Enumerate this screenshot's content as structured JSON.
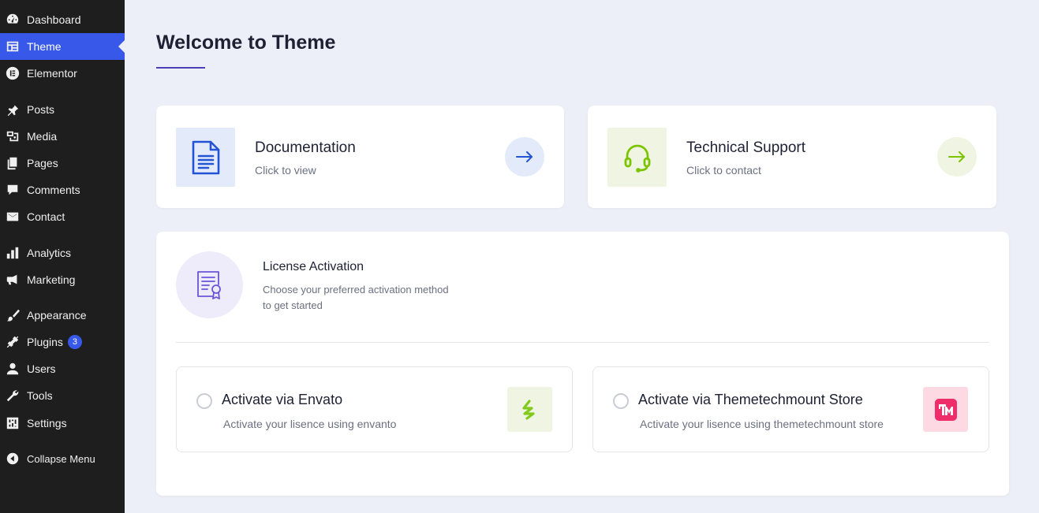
{
  "sidebar": {
    "items": [
      {
        "label": "Dashboard",
        "icon": "dashboard-icon"
      },
      {
        "label": "Theme",
        "icon": "theme-icon",
        "active": true
      },
      {
        "label": "Elementor",
        "icon": "elementor-icon"
      },
      {
        "label": "Posts",
        "icon": "pin-icon"
      },
      {
        "label": "Media",
        "icon": "media-icon"
      },
      {
        "label": "Pages",
        "icon": "pages-icon"
      },
      {
        "label": "Comments",
        "icon": "comment-icon"
      },
      {
        "label": "Contact",
        "icon": "envelope-icon"
      },
      {
        "label": "Analytics",
        "icon": "bar-chart-icon"
      },
      {
        "label": "Marketing",
        "icon": "megaphone-icon"
      },
      {
        "label": "Appearance",
        "icon": "paintbrush-icon"
      },
      {
        "label": "Plugins",
        "icon": "plug-icon",
        "badge": "3"
      },
      {
        "label": "Users",
        "icon": "user-icon"
      },
      {
        "label": "Tools",
        "icon": "wrench-icon"
      },
      {
        "label": "Settings",
        "icon": "sliders-icon"
      },
      {
        "label": "Collapse Menu",
        "icon": "collapse-icon"
      }
    ]
  },
  "main": {
    "title": "Welcome to Theme",
    "documentation": {
      "title": "Documentation",
      "subtitle": "Click to view",
      "icon": "document-icon",
      "arrow": "arrow-right-icon"
    },
    "support": {
      "title": "Technical Support",
      "subtitle": "Click to contact",
      "icon": "headset-icon",
      "arrow": "arrow-right-icon"
    },
    "license": {
      "title": "License Activation",
      "subtitle_line1": "Choose your preferred activation method",
      "subtitle_line2": "to get started",
      "icon": "certificate-icon",
      "options": [
        {
          "title": "Activate via Envato",
          "subtitle": "Activate your lisence using envanto",
          "icon": "envato-logo-icon"
        },
        {
          "title": "Activate via Themetechmount Store",
          "subtitle": "Activate your lisence using themetechmount store",
          "icon": "themetechmount-logo-icon"
        }
      ]
    }
  },
  "colors": {
    "accent": "#3858e9",
    "sidebar_bg": "#1e1e1e",
    "page_bg": "#edeff8",
    "doc_blue": "#2454d6",
    "support_green": "#7cc400",
    "license_purple": "#6a55d8",
    "tm_pink": "#ef2d6b"
  }
}
